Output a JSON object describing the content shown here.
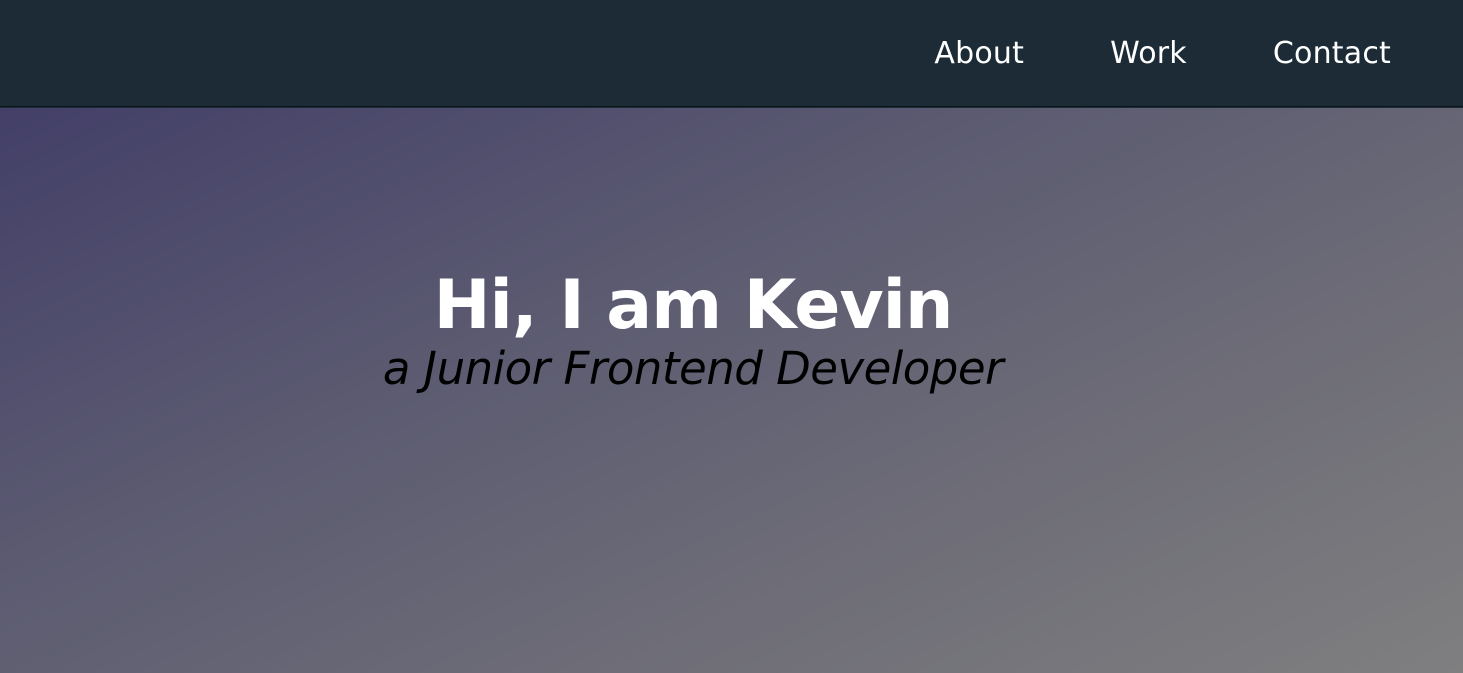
{
  "nav": {
    "items": [
      {
        "label": "About"
      },
      {
        "label": "Work"
      },
      {
        "label": "Contact"
      }
    ]
  },
  "hero": {
    "title": "Hi, I am Kevin",
    "subtitle": "a Junior Frontend Developer"
  },
  "colors": {
    "navbar_background": "#1c2b35",
    "hero_gradient_start": "#433f68",
    "hero_gradient_end": "#7f7f80",
    "title_color": "#ffffff",
    "subtitle_color": "#000000"
  }
}
